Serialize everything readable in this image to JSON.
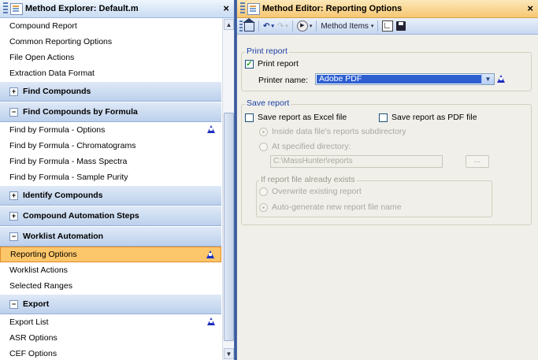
{
  "explorer": {
    "title": "Method Explorer: Default.m",
    "close_glyph": "×",
    "items": [
      {
        "type": "item",
        "label": "Compound Report"
      },
      {
        "type": "item",
        "label": "Common Reporting Options"
      },
      {
        "type": "item",
        "label": "File Open Actions"
      },
      {
        "type": "item",
        "label": "Extraction Data Format"
      },
      {
        "type": "section",
        "label": "Find Compounds",
        "expanded": false
      },
      {
        "type": "section",
        "label": "Find Compounds by Formula",
        "expanded": true
      },
      {
        "type": "item",
        "label": "Find by Formula - Options",
        "warning": true
      },
      {
        "type": "item",
        "label": "Find by Formula - Chromatograms"
      },
      {
        "type": "item",
        "label": "Find by Formula - Mass Spectra"
      },
      {
        "type": "item",
        "label": "Find by Formula - Sample Purity"
      },
      {
        "type": "section",
        "label": "Identify Compounds",
        "expanded": false
      },
      {
        "type": "section",
        "label": "Compound Automation Steps",
        "expanded": false
      },
      {
        "type": "section",
        "label": "Worklist Automation",
        "expanded": true
      },
      {
        "type": "item",
        "label": "Reporting Options",
        "warning": true,
        "selected": true
      },
      {
        "type": "item",
        "label": "Worklist Actions"
      },
      {
        "type": "item",
        "label": "Selected Ranges"
      },
      {
        "type": "section",
        "label": "Export",
        "expanded": true
      },
      {
        "type": "item",
        "label": "Export List",
        "warning": true
      },
      {
        "type": "item",
        "label": "ASR Options"
      },
      {
        "type": "item",
        "label": "CEF Options"
      }
    ]
  },
  "editor": {
    "title": "Method Editor: Reporting Options",
    "close_glyph": "×",
    "toolbar": {
      "method_items_label": "Method Items",
      "icons": [
        "home-icon",
        "undo-icon",
        "redo-icon",
        "run-icon",
        "new-method-icon",
        "save-icon"
      ]
    },
    "print_report": {
      "group_label": "Print report",
      "checkbox_label": "Print report",
      "checked": true,
      "printer_label": "Printer name:",
      "printer_value": "Adobe PDF"
    },
    "save_report": {
      "group_label": "Save report",
      "excel_label": "Save report as Excel file",
      "pdf_label": "Save report as PDF file",
      "radio_inside": "Inside data file's reports subdirectory",
      "radio_specified": "At specified directory:",
      "directory_value": "C:\\MassHunter\\reports",
      "browse_label": "...",
      "exists_group_label": "If report file already exists",
      "radio_overwrite": "Overwrite existing report",
      "radio_autogen": "Auto-generate new report file name"
    }
  },
  "colors": {
    "selected_bg": "#fcc66a",
    "warning_icon": "#1f2fbf",
    "section_bg": "#bcd0ec",
    "editor_title_bg": "#f7c773",
    "combo_selection": "#2e5fd1"
  }
}
